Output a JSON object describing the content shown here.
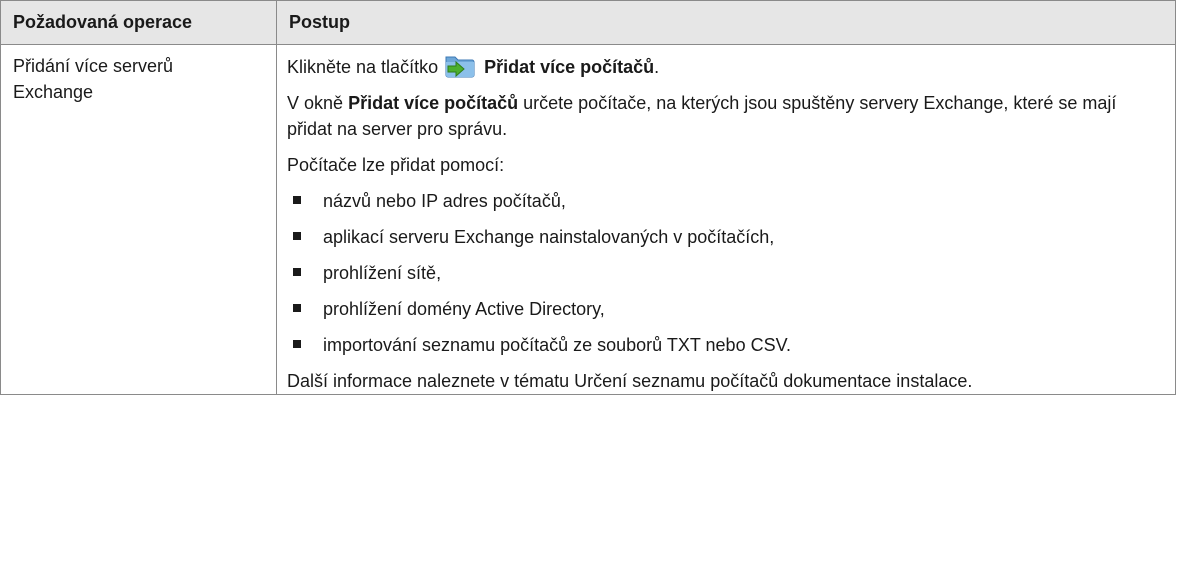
{
  "table": {
    "headers": [
      "Požadovaná operace",
      "Postup"
    ],
    "operation": [
      "Přidání více serverů",
      "Exchange"
    ],
    "click_prefix": "Klikněte na tlačítko",
    "button_label": "Přidat více počítačů",
    "click_suffix": ".",
    "window_prefix": "V okně",
    "window_name": "Přidat více počítačů",
    "window_suffix": "určete počítače, na kterých jsou spuštěny servery Exchange, které se mají přidat na server pro správu.",
    "methods_intro": "Počítače lze přidat pomocí:",
    "methods": [
      "názvů nebo IP adres počítačů,",
      "aplikací serveru Exchange nainstalovaných v počítačích,",
      "prohlížení sítě,",
      "prohlížení domény Active Directory,",
      "importování seznamu počítačů ze souborů TXT nebo CSV."
    ],
    "more_info": "Další informace naleznete v tématu Určení seznamu počítačů dokumentace instalace."
  },
  "icons": {
    "add_multiple": "add-multiple-computers-icon"
  },
  "colors": {
    "header_bg": "#e6e6e6",
    "border": "#8a8a8a",
    "icon_folder": "#6ea7d8",
    "icon_arrow": "#4caf2e"
  }
}
